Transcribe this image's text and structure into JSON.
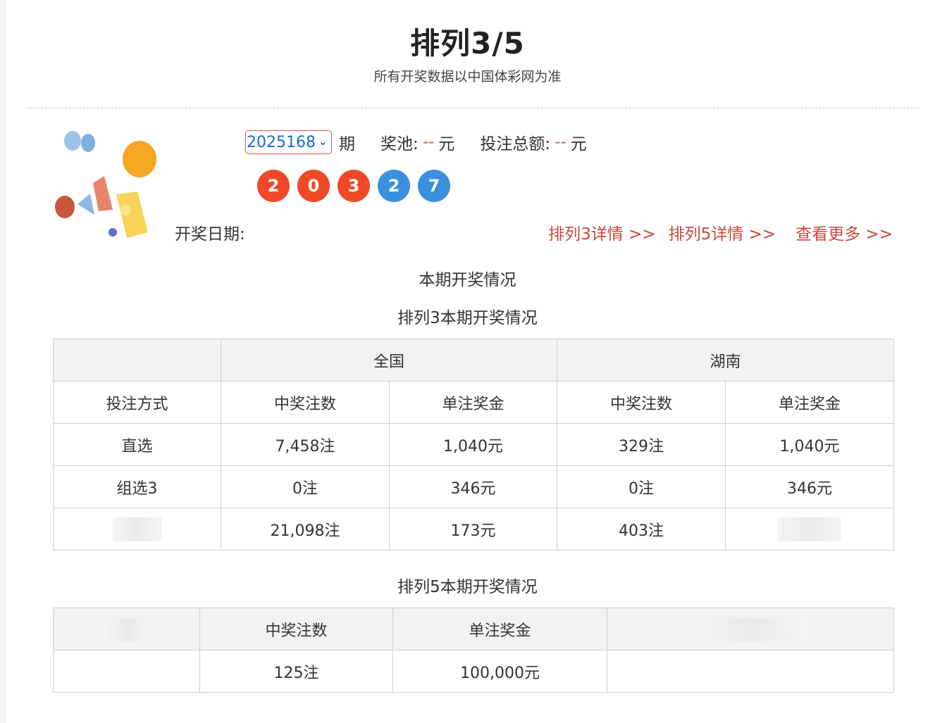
{
  "header": {
    "title": "排列3/5",
    "subtitle": "所有开奖数据以中国体彩网为准"
  },
  "draw_info": {
    "issue_value": "2025168",
    "issue_suffix": "期",
    "pool_label": "奖池:",
    "pool_value": "--",
    "pool_unit": "元",
    "total_label": "投注总额:",
    "total_value": "--",
    "total_unit": "元",
    "numbers": [
      "2",
      "0",
      "3",
      "2",
      "7"
    ],
    "date_label": "开奖日期:"
  },
  "links": {
    "p3_detail": "排列3详情 >>",
    "p5_detail": "排列5详情 >>",
    "more": "查看更多 >>"
  },
  "sections": {
    "current": "本期开奖情况",
    "p3": "排列3本期开奖情况",
    "p5": "排列5本期开奖情况"
  },
  "table_p3": {
    "group_headers": [
      "全国",
      "湖南"
    ],
    "columns": [
      "投注方式",
      "中奖注数",
      "单注奖金",
      "中奖注数",
      "单注奖金"
    ],
    "rows": [
      [
        "直选",
        "7,458注",
        "1,040元",
        "329注",
        "1,040元"
      ],
      [
        "组选3",
        "0注",
        "346元",
        "0注",
        "346元"
      ],
      [
        "",
        "21,098注",
        "173元",
        "403注",
        ""
      ]
    ]
  },
  "table_p5": {
    "columns": [
      "",
      "中奖注数",
      "单注奖金",
      ""
    ],
    "rows": [
      [
        "",
        "125注",
        "100,000元",
        ""
      ]
    ]
  },
  "colors": {
    "accent_red": "#d9534f",
    "link_red": "#c9483f",
    "ball_red": "#f0492a",
    "ball_blue": "#3a8fde",
    "select_text": "#1a6fc6"
  }
}
